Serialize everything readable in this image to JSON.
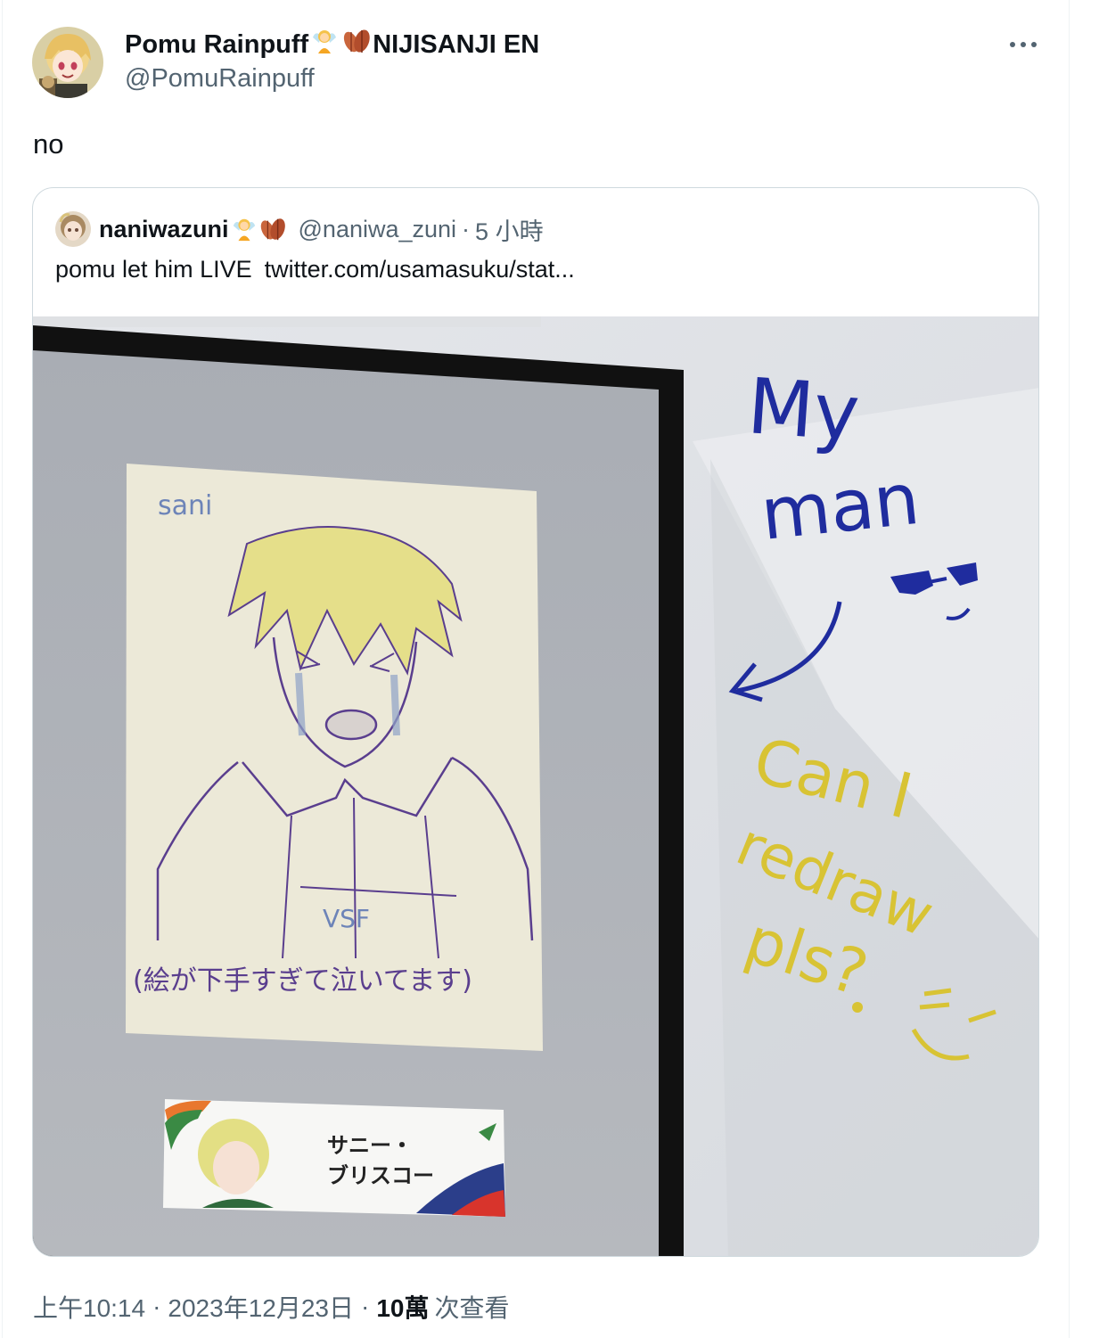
{
  "author": {
    "display_name": "Pomu Rainpuff",
    "name_suffix": "NIJISANJI EN",
    "handle": "@PomuRainpuff",
    "avatar_icon": "avatar-blonde-girl"
  },
  "tweet": {
    "text": "no"
  },
  "quote": {
    "display_name": "naniwazuni",
    "handle": "@naniwa_zuni",
    "separator": "·",
    "time": "5 小時",
    "text": "pomu let him LIVE",
    "link": "twitter.com/usamasuku/stat...",
    "photo": {
      "drawing_label": "sani",
      "shirt_text": "VSF",
      "caption_jp": "(絵が下手すぎて泣いてます)",
      "whiteboard_blue_1": "My",
      "whiteboard_blue_2": "man",
      "whiteboard_yellow_1": "Can I",
      "whiteboard_yellow_2": "redraw",
      "whiteboard_yellow_3": "pls?",
      "nameplate_line1": "サニー・",
      "nameplate_line2": "ブリスコー"
    }
  },
  "meta": {
    "time": "上午10:14",
    "separator": "·",
    "date": "2023年12月23日",
    "views_count": "10萬",
    "views_label": "次查看"
  },
  "icons": {
    "more": "more-horizontal-icon",
    "fairy_emoji": "fairy-emoji",
    "leaf_emoji": "leaves-emoji"
  }
}
